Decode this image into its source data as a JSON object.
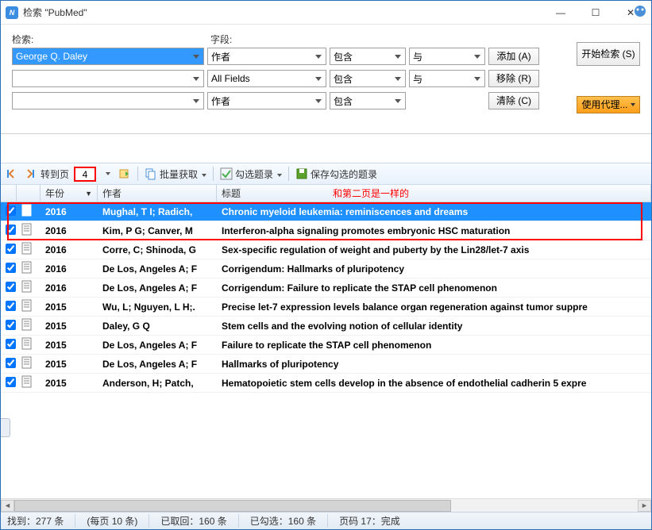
{
  "window": {
    "title": "检索 \"PubMed\"",
    "minimize": "—",
    "maximize": "☐",
    "close": "✕"
  },
  "search": {
    "label_search": "检索:",
    "label_field": "字段:",
    "input1": "George Q. Daley",
    "input2": "",
    "input3": "",
    "field1": "作者",
    "field2": "All Fields",
    "field3": "作者",
    "cond1": "包含",
    "cond2": "包含",
    "cond3": "包含",
    "op1": "与",
    "op2": "与",
    "btn_add": "添加 (A)",
    "btn_remove": "移除 (R)",
    "btn_clear": "清除 (C)",
    "btn_start": "开始检索 (S)",
    "btn_proxy": "使用代理..."
  },
  "toolbar": {
    "goto": "转到页",
    "page": "4",
    "batch": "批量获取",
    "check": "勾选题录",
    "save": "保存勾选的题录"
  },
  "headers": {
    "year": "年份",
    "author": "作者",
    "title": "标题"
  },
  "annotation": "和第二页是一样的",
  "rows": [
    {
      "year": "2016",
      "author": "Mughal, T I; Radich,",
      "title": "Chronic myeloid leukemia: reminiscences and dreams",
      "selected": true
    },
    {
      "year": "2016",
      "author": "Kim, P G; Canver, M",
      "title": "Interferon-alpha signaling promotes embryonic HSC maturation",
      "selected": false
    },
    {
      "year": "2016",
      "author": "Corre, C; Shinoda, G",
      "title": "Sex-specific regulation of weight and puberty by the Lin28/let-7 axis",
      "selected": false
    },
    {
      "year": "2016",
      "author": "De Los, Angeles A; F",
      "title": "Corrigendum: Hallmarks of pluripotency",
      "selected": false
    },
    {
      "year": "2016",
      "author": "De Los, Angeles A; F",
      "title": "Corrigendum: Failure to replicate the STAP cell phenomenon",
      "selected": false
    },
    {
      "year": "2015",
      "author": "Wu, L; Nguyen, L H;.",
      "title": "Precise let-7 expression levels balance organ regeneration against tumor suppre",
      "selected": false
    },
    {
      "year": "2015",
      "author": "Daley, G Q",
      "title": "Stem cells and the evolving notion of cellular identity",
      "selected": false
    },
    {
      "year": "2015",
      "author": "De Los, Angeles A; F",
      "title": "Failure to replicate the STAP cell phenomenon",
      "selected": false
    },
    {
      "year": "2015",
      "author": "De Los, Angeles A; F",
      "title": "Hallmarks of pluripotency",
      "selected": false
    },
    {
      "year": "2015",
      "author": "Anderson, H; Patch,",
      "title": "Hematopoietic stem cells develop in the absence of endothelial cadherin 5 expre",
      "selected": false
    }
  ],
  "status": {
    "found": "找到：277 条",
    "perpage": "(每页 10 条)",
    "fetched": "已取回：160 条",
    "checked": "已勾选：160 条",
    "page": "页码 17：完成"
  }
}
